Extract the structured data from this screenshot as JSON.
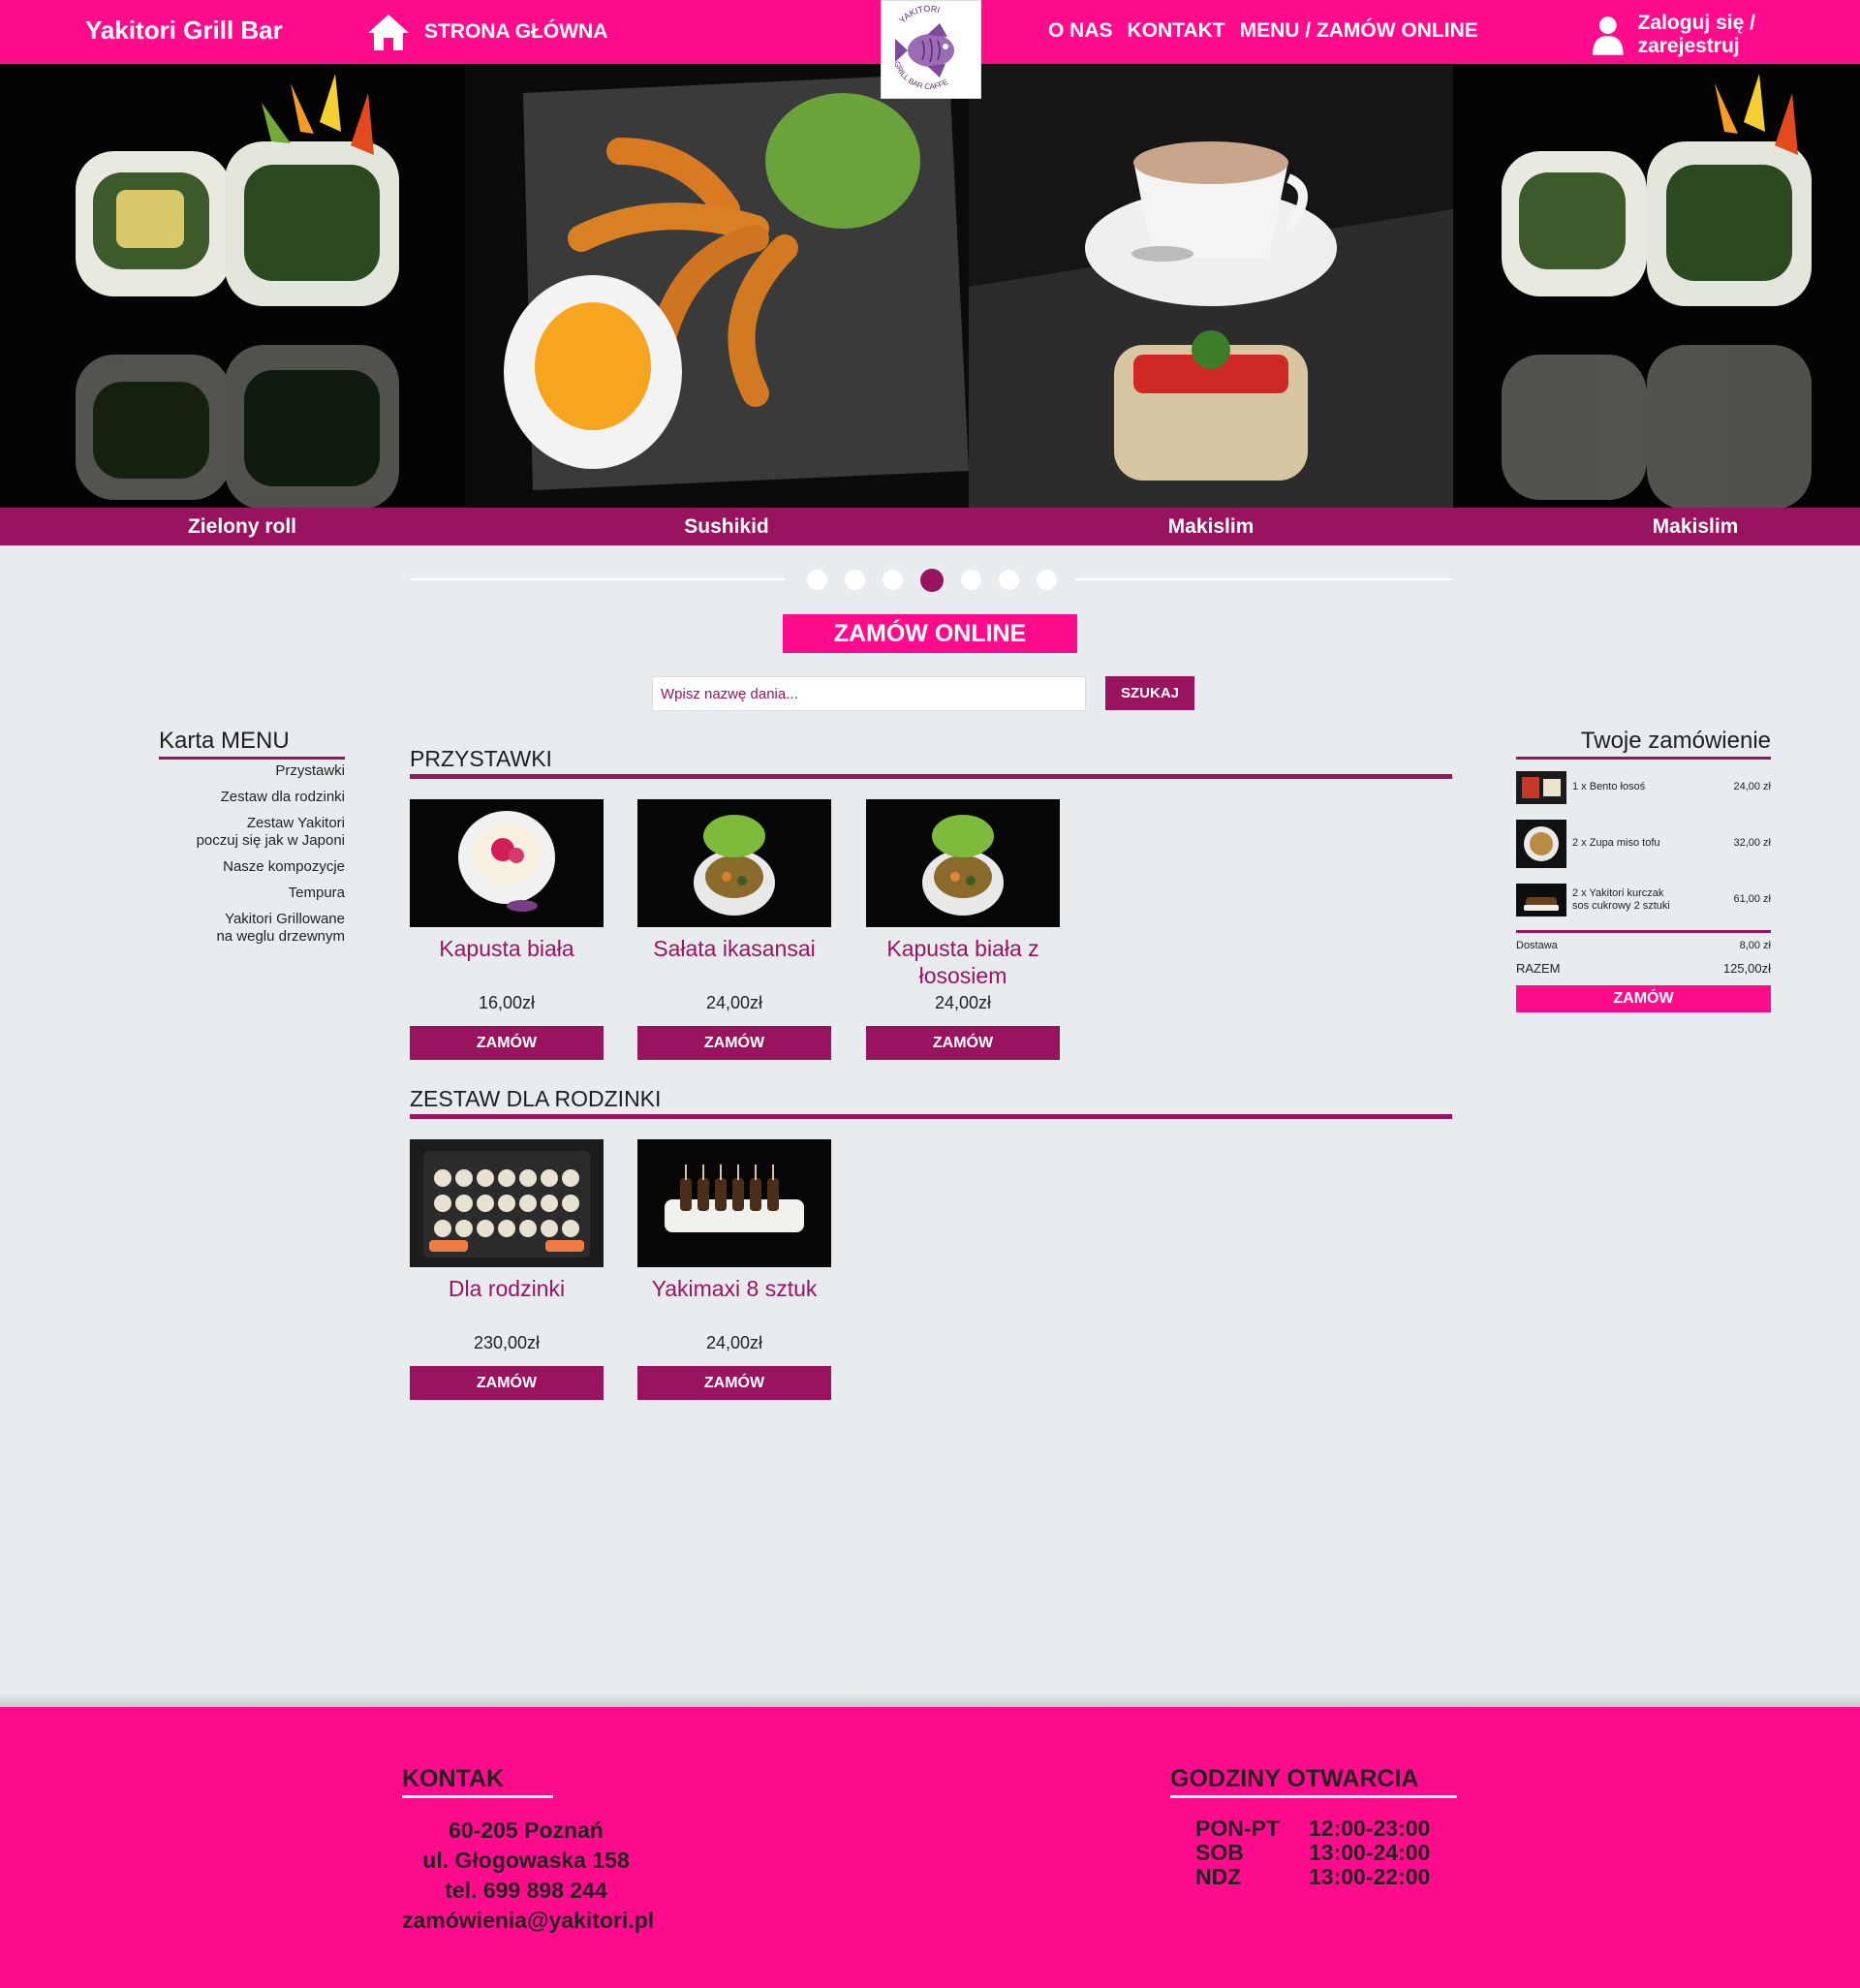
{
  "header": {
    "brand": "Yakitori Grill Bar",
    "home": "STRONA GŁÓWNA",
    "nav": [
      "O NAS",
      "KONTAKT",
      "MENU / ZAMÓW ONLINE"
    ],
    "login": "Zaloguj się / zarejestruj"
  },
  "logo": {
    "top": "YAKITORI",
    "bottom": "GRILL BAR CAFFE"
  },
  "slider": {
    "captions": [
      "Zielony roll",
      "Sushikid",
      "Makislim",
      "Makislim"
    ],
    "dot_count": 7,
    "active_dot": 4
  },
  "order_online": "ZAMÓW ONLINE",
  "search": {
    "placeholder": "Wpisz nazwę dania...",
    "button": "SZUKAJ"
  },
  "menu": {
    "title": "Karta MENU",
    "items": [
      "Przystawki",
      "Zestaw dla rodzinki",
      "Zestaw Yakitori\npoczuj się jak w Japoni",
      "Nasze kompozycje",
      "Tempura",
      "Yakitori Grillowane\nna weglu drzewnym"
    ]
  },
  "sections": [
    {
      "title": "PRZYSTAWKI",
      "products": [
        {
          "name": "Kapusta biała",
          "price": "16,00zł",
          "button": "ZAMÓW"
        },
        {
          "name": "Sałata ikasansai",
          "price": "24,00zł",
          "button": "ZAMÓW"
        },
        {
          "name": "Kapusta biała z łososiem",
          "price": "24,00zł",
          "button": "ZAMÓW"
        }
      ]
    },
    {
      "title": "ZESTAW DLA RODZINKI",
      "products": [
        {
          "name": "Dla rodzinki",
          "price": "230,00zł",
          "button": "ZAMÓW"
        },
        {
          "name": "Yakimaxi  8 sztuk",
          "price": "24,00zł",
          "button": "ZAMÓW"
        }
      ]
    }
  ],
  "cart": {
    "title": "Twoje zamówienie",
    "items": [
      {
        "name": "1 x Bento łosoś",
        "price": "24,00 zł"
      },
      {
        "name": "2 x Zupa miso tofu",
        "price": "32,00 zł"
      },
      {
        "name": "2 x Yakitori kurczak\nsos cukrowy 2 sztuki",
        "price": "61,00 zł"
      }
    ],
    "delivery_label": "Dostawa",
    "delivery_value": "8,00 zł",
    "total_label": "RAZEM",
    "total_value": "125,00zł",
    "button": "ZAMÓW"
  },
  "footer": {
    "contact_title": "KONTAK",
    "contact_lines": [
      "60-205 Poznań",
      "ul. Głogowaska 158",
      "tel. 699 898 244",
      "zamówienia@yakitori.pl"
    ],
    "hours_title": "GODZINY OTWARCIA",
    "hours": [
      {
        "day": "PON-PT",
        "time": "12:00-23:00"
      },
      {
        "day": "SOB",
        "time": "13:00-24:00"
      },
      {
        "day": "NDZ",
        "time": "13:00-22:00"
      }
    ]
  },
  "colors": {
    "primary": "#ff0c8c",
    "secondary": "#99145e",
    "background": "#e9ecee"
  }
}
